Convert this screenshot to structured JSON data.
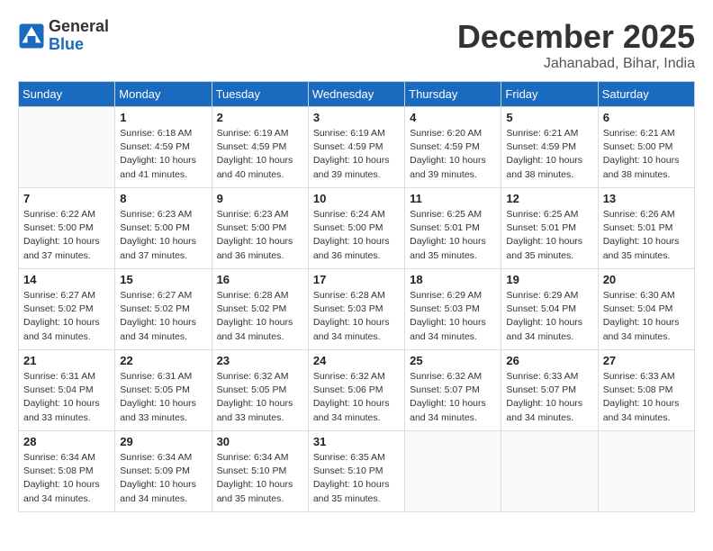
{
  "header": {
    "logo_general": "General",
    "logo_blue": "Blue",
    "month_title": "December 2025",
    "location": "Jahanabad, Bihar, India"
  },
  "days_of_week": [
    "Sunday",
    "Monday",
    "Tuesday",
    "Wednesday",
    "Thursday",
    "Friday",
    "Saturday"
  ],
  "weeks": [
    [
      {
        "day": "",
        "sunrise": "",
        "sunset": "",
        "daylight": ""
      },
      {
        "day": "1",
        "sunrise": "Sunrise: 6:18 AM",
        "sunset": "Sunset: 4:59 PM",
        "daylight": "Daylight: 10 hours and 41 minutes."
      },
      {
        "day": "2",
        "sunrise": "Sunrise: 6:19 AM",
        "sunset": "Sunset: 4:59 PM",
        "daylight": "Daylight: 10 hours and 40 minutes."
      },
      {
        "day": "3",
        "sunrise": "Sunrise: 6:19 AM",
        "sunset": "Sunset: 4:59 PM",
        "daylight": "Daylight: 10 hours and 39 minutes."
      },
      {
        "day": "4",
        "sunrise": "Sunrise: 6:20 AM",
        "sunset": "Sunset: 4:59 PM",
        "daylight": "Daylight: 10 hours and 39 minutes."
      },
      {
        "day": "5",
        "sunrise": "Sunrise: 6:21 AM",
        "sunset": "Sunset: 4:59 PM",
        "daylight": "Daylight: 10 hours and 38 minutes."
      },
      {
        "day": "6",
        "sunrise": "Sunrise: 6:21 AM",
        "sunset": "Sunset: 5:00 PM",
        "daylight": "Daylight: 10 hours and 38 minutes."
      }
    ],
    [
      {
        "day": "7",
        "sunrise": "Sunrise: 6:22 AM",
        "sunset": "Sunset: 5:00 PM",
        "daylight": "Daylight: 10 hours and 37 minutes."
      },
      {
        "day": "8",
        "sunrise": "Sunrise: 6:23 AM",
        "sunset": "Sunset: 5:00 PM",
        "daylight": "Daylight: 10 hours and 37 minutes."
      },
      {
        "day": "9",
        "sunrise": "Sunrise: 6:23 AM",
        "sunset": "Sunset: 5:00 PM",
        "daylight": "Daylight: 10 hours and 36 minutes."
      },
      {
        "day": "10",
        "sunrise": "Sunrise: 6:24 AM",
        "sunset": "Sunset: 5:00 PM",
        "daylight": "Daylight: 10 hours and 36 minutes."
      },
      {
        "day": "11",
        "sunrise": "Sunrise: 6:25 AM",
        "sunset": "Sunset: 5:01 PM",
        "daylight": "Daylight: 10 hours and 35 minutes."
      },
      {
        "day": "12",
        "sunrise": "Sunrise: 6:25 AM",
        "sunset": "Sunset: 5:01 PM",
        "daylight": "Daylight: 10 hours and 35 minutes."
      },
      {
        "day": "13",
        "sunrise": "Sunrise: 6:26 AM",
        "sunset": "Sunset: 5:01 PM",
        "daylight": "Daylight: 10 hours and 35 minutes."
      }
    ],
    [
      {
        "day": "14",
        "sunrise": "Sunrise: 6:27 AM",
        "sunset": "Sunset: 5:02 PM",
        "daylight": "Daylight: 10 hours and 34 minutes."
      },
      {
        "day": "15",
        "sunrise": "Sunrise: 6:27 AM",
        "sunset": "Sunset: 5:02 PM",
        "daylight": "Daylight: 10 hours and 34 minutes."
      },
      {
        "day": "16",
        "sunrise": "Sunrise: 6:28 AM",
        "sunset": "Sunset: 5:02 PM",
        "daylight": "Daylight: 10 hours and 34 minutes."
      },
      {
        "day": "17",
        "sunrise": "Sunrise: 6:28 AM",
        "sunset": "Sunset: 5:03 PM",
        "daylight": "Daylight: 10 hours and 34 minutes."
      },
      {
        "day": "18",
        "sunrise": "Sunrise: 6:29 AM",
        "sunset": "Sunset: 5:03 PM",
        "daylight": "Daylight: 10 hours and 34 minutes."
      },
      {
        "day": "19",
        "sunrise": "Sunrise: 6:29 AM",
        "sunset": "Sunset: 5:04 PM",
        "daylight": "Daylight: 10 hours and 34 minutes."
      },
      {
        "day": "20",
        "sunrise": "Sunrise: 6:30 AM",
        "sunset": "Sunset: 5:04 PM",
        "daylight": "Daylight: 10 hours and 34 minutes."
      }
    ],
    [
      {
        "day": "21",
        "sunrise": "Sunrise: 6:31 AM",
        "sunset": "Sunset: 5:04 PM",
        "daylight": "Daylight: 10 hours and 33 minutes."
      },
      {
        "day": "22",
        "sunrise": "Sunrise: 6:31 AM",
        "sunset": "Sunset: 5:05 PM",
        "daylight": "Daylight: 10 hours and 33 minutes."
      },
      {
        "day": "23",
        "sunrise": "Sunrise: 6:32 AM",
        "sunset": "Sunset: 5:05 PM",
        "daylight": "Daylight: 10 hours and 33 minutes."
      },
      {
        "day": "24",
        "sunrise": "Sunrise: 6:32 AM",
        "sunset": "Sunset: 5:06 PM",
        "daylight": "Daylight: 10 hours and 34 minutes."
      },
      {
        "day": "25",
        "sunrise": "Sunrise: 6:32 AM",
        "sunset": "Sunset: 5:07 PM",
        "daylight": "Daylight: 10 hours and 34 minutes."
      },
      {
        "day": "26",
        "sunrise": "Sunrise: 6:33 AM",
        "sunset": "Sunset: 5:07 PM",
        "daylight": "Daylight: 10 hours and 34 minutes."
      },
      {
        "day": "27",
        "sunrise": "Sunrise: 6:33 AM",
        "sunset": "Sunset: 5:08 PM",
        "daylight": "Daylight: 10 hours and 34 minutes."
      }
    ],
    [
      {
        "day": "28",
        "sunrise": "Sunrise: 6:34 AM",
        "sunset": "Sunset: 5:08 PM",
        "daylight": "Daylight: 10 hours and 34 minutes."
      },
      {
        "day": "29",
        "sunrise": "Sunrise: 6:34 AM",
        "sunset": "Sunset: 5:09 PM",
        "daylight": "Daylight: 10 hours and 34 minutes."
      },
      {
        "day": "30",
        "sunrise": "Sunrise: 6:34 AM",
        "sunset": "Sunset: 5:10 PM",
        "daylight": "Daylight: 10 hours and 35 minutes."
      },
      {
        "day": "31",
        "sunrise": "Sunrise: 6:35 AM",
        "sunset": "Sunset: 5:10 PM",
        "daylight": "Daylight: 10 hours and 35 minutes."
      },
      {
        "day": "",
        "sunrise": "",
        "sunset": "",
        "daylight": ""
      },
      {
        "day": "",
        "sunrise": "",
        "sunset": "",
        "daylight": ""
      },
      {
        "day": "",
        "sunrise": "",
        "sunset": "",
        "daylight": ""
      }
    ]
  ]
}
